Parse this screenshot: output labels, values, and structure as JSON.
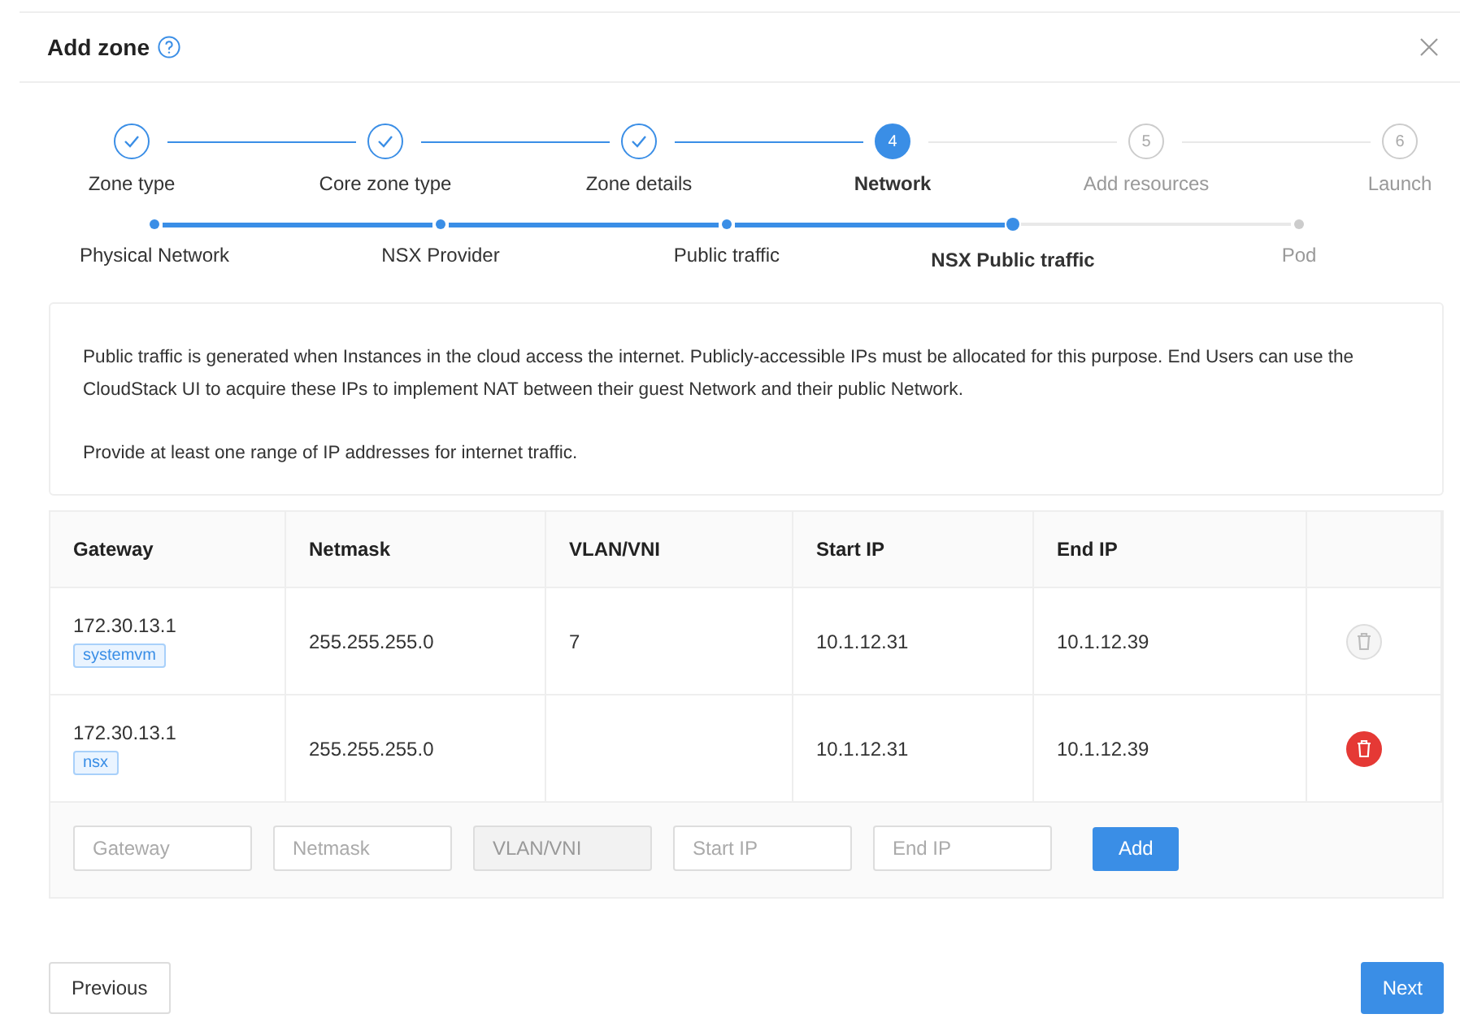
{
  "modal": {
    "title": "Add zone"
  },
  "steps": [
    {
      "label": "Zone type",
      "done": true,
      "selected": false
    },
    {
      "label": "Core zone type",
      "done": true,
      "selected": false
    },
    {
      "label": "Zone details",
      "done": true,
      "selected": false
    },
    {
      "label": "Network",
      "number": "4",
      "done": false,
      "selected": true
    },
    {
      "label": "Add resources",
      "number": "5",
      "done": false,
      "selected": false
    },
    {
      "label": "Launch",
      "number": "6",
      "done": false,
      "selected": false
    }
  ],
  "substeps": [
    {
      "label": "Physical Network",
      "done": true,
      "selected": false
    },
    {
      "label": "NSX Provider",
      "done": true,
      "selected": false
    },
    {
      "label": "Public traffic",
      "done": true,
      "selected": false
    },
    {
      "label": "NSX Public traffic",
      "done": false,
      "selected": true
    },
    {
      "label": "Pod",
      "done": false,
      "selected": false
    }
  ],
  "description": [
    "Public traffic is generated when Instances in the cloud access the internet. Publicly-accessible IPs must be allocated for this purpose. End Users can use the CloudStack UI to acquire these IPs to implement NAT between their guest Network and their public Network.",
    "Provide at least one range of IP addresses for internet traffic."
  ],
  "table": {
    "columns": [
      "Gateway",
      "Netmask",
      "VLAN/VNI",
      "Start IP",
      "End IP"
    ],
    "rows": [
      {
        "gateway": "172.30.13.1",
        "tag": "systemvm",
        "netmask": "255.255.255.0",
        "vlan": "7",
        "start_ip": "10.1.12.31",
        "end_ip": "10.1.12.39",
        "delete_disabled": true
      },
      {
        "gateway": "172.30.13.1",
        "tag": "nsx",
        "netmask": "255.255.255.0",
        "start_ip": "10.1.12.31",
        "end_ip": "10.1.12.39",
        "delete_disabled": false
      }
    ],
    "inputs": [
      {
        "placeholder": "Gateway",
        "disabled": false
      },
      {
        "placeholder": "Netmask",
        "disabled": false
      },
      {
        "placeholder": "VLAN/VNI",
        "disabled": true
      },
      {
        "placeholder": "Start IP",
        "disabled": false
      },
      {
        "placeholder": "End IP",
        "disabled": false
      }
    ],
    "add_button": "Add"
  },
  "footer": {
    "previous": "Previous",
    "next": "Next"
  }
}
